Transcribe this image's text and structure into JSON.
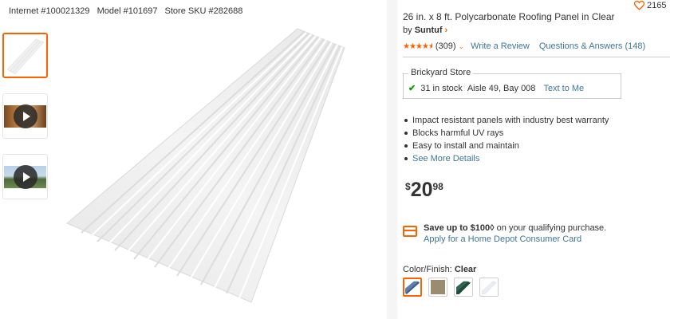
{
  "ids": {
    "internet": "Internet #100021329",
    "model": "Model #101697",
    "sku": "Store SKU #282688"
  },
  "thumbnails": [
    {
      "type": "image",
      "label": "panel-image",
      "active": true
    },
    {
      "type": "video",
      "label": "video-1"
    },
    {
      "type": "video",
      "label": "video-2"
    }
  ],
  "product": {
    "title": "26 in. x 8 ft. Polycarbonate Roofing Panel in Clear",
    "by": "by",
    "brand": "Suntuf",
    "favorites": "2165",
    "rating_count": "(309)",
    "rating_value": 4.5,
    "write_review": "Write a Review",
    "qa": "Questions & Answers (148)"
  },
  "store": {
    "name": "Brickyard Store",
    "stock": "31 in stock",
    "aisle": "Aisle 49, Bay 008",
    "text_me": "Text to Me"
  },
  "bullets": [
    "Impact resistant panels with industry best warranty",
    "Blocks harmful UV rays",
    "Easy to install and maintain"
  ],
  "see_more": "See More Details",
  "price": {
    "currency": "$",
    "dollars": "20",
    "cents": "98"
  },
  "promo": {
    "bold": "Save up to $100◊",
    "rest": " on your qualifying purchase.",
    "link": "Apply for a Home Depot Consumer Card"
  },
  "color": {
    "label": "Color/Finish:",
    "value": "Clear",
    "swatches": [
      {
        "name": "blue",
        "color": "#3d5f8c",
        "active": true
      },
      {
        "name": "tan",
        "color": "#9a8c6e"
      },
      {
        "name": "green",
        "color": "#1f4d3a"
      },
      {
        "name": "clear",
        "color": "#e8eef3"
      }
    ]
  },
  "colors": {
    "accent": "#f96302",
    "link": "#3e7697",
    "stock_check": "#00a000"
  }
}
